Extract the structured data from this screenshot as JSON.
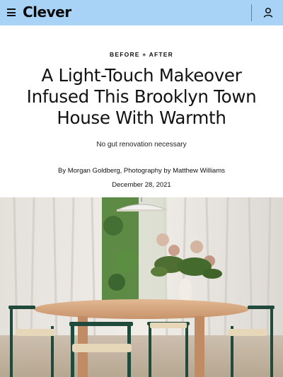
{
  "header": {
    "logo": "Clever",
    "menu_icon": "hamburger-menu-icon",
    "account_icon": "user-account-icon",
    "background_color": "#a9d3f6"
  },
  "article": {
    "kicker": "BEFORE + AFTER",
    "headline_lines": [
      "A Light-Touch Makeover",
      "Infused This Brooklyn Town",
      "House With Warmth"
    ],
    "dek": "No gut renovation necessary",
    "byline": "By Morgan Goldberg, Photography by Matthew Williams",
    "date": "December 28, 2021"
  }
}
